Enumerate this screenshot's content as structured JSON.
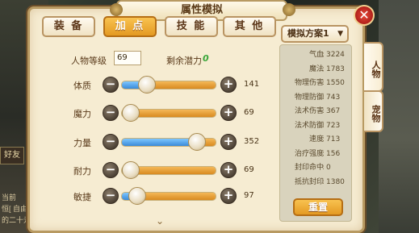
{
  "window": {
    "title": "属性模拟"
  },
  "tabs": [
    {
      "label": "装 备",
      "active": false
    },
    {
      "label": "加 点",
      "active": true
    },
    {
      "label": "技 能",
      "active": false
    },
    {
      "label": "其 他",
      "active": false
    }
  ],
  "level": {
    "label": "人物等级",
    "value": "69"
  },
  "potential": {
    "label": "剩余潜力",
    "value": "0"
  },
  "stats": [
    {
      "label": "体质",
      "value": "141",
      "fill": 0.27
    },
    {
      "label": "魔力",
      "value": "69",
      "fill": 0.1
    },
    {
      "label": "力量",
      "value": "352",
      "fill": 0.8
    },
    {
      "label": "耐力",
      "value": "69",
      "fill": 0.1
    },
    {
      "label": "敏捷",
      "value": "97",
      "fill": 0.17
    }
  ],
  "scheme_select": {
    "value": "模拟方案1"
  },
  "attributes": [
    {
      "key": "气血",
      "value": "3224"
    },
    {
      "key": "魔法",
      "value": "1783"
    },
    {
      "key": "物理伤害",
      "value": "1550"
    },
    {
      "key": "物理防御",
      "value": "743"
    },
    {
      "key": "法术伤害",
      "value": "367"
    },
    {
      "key": "法术防御",
      "value": "723"
    },
    {
      "key": "速度",
      "value": "713"
    },
    {
      "key": "治疗强度",
      "value": "156"
    },
    {
      "key": "封印命中",
      "value": "0"
    },
    {
      "key": "抵抗封印",
      "value": "1380"
    }
  ],
  "reset_label": "重置",
  "side_tabs": [
    {
      "label": "人物",
      "active": true
    },
    {
      "label": "宠物",
      "active": false
    }
  ],
  "background": {
    "friends_label": "好友",
    "left_snippets": [
      "当前",
      "恒[ 自由",
      "的二十元"
    ]
  },
  "colors": {
    "accent": "#e49a22",
    "panel": "#f6ecd2",
    "slider_blue": "#3a8ad8",
    "close_red": "#b0201a"
  }
}
